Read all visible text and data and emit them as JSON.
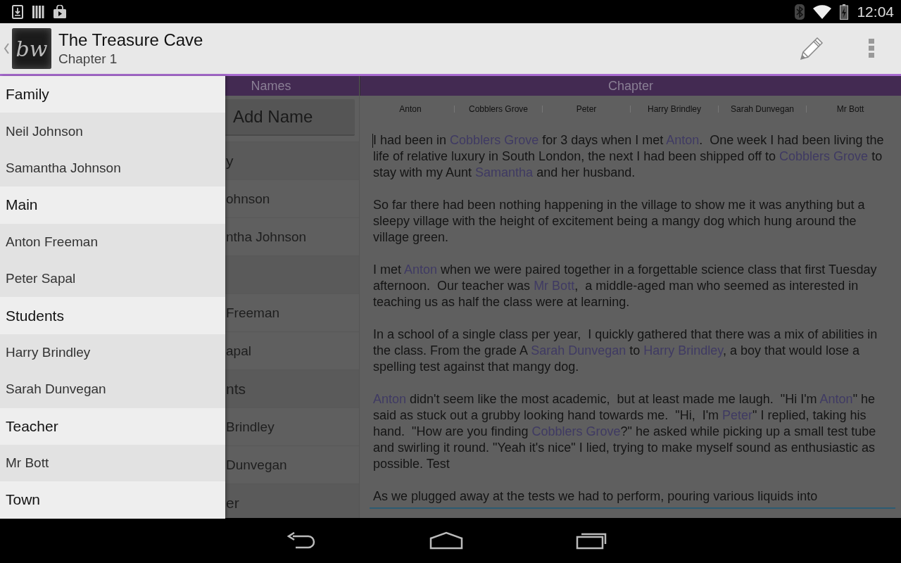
{
  "status_bar": {
    "time": "12:04"
  },
  "action_bar": {
    "logo_text": "bw",
    "title": "The Treasure Cave",
    "subtitle": "Chapter 1"
  },
  "drawer": {
    "items": [
      {
        "kind": "header",
        "label": "Family"
      },
      {
        "kind": "name",
        "label": "Neil Johnson"
      },
      {
        "kind": "name",
        "label": "Samantha Johnson"
      },
      {
        "kind": "header",
        "label": "Main"
      },
      {
        "kind": "name",
        "label": "Anton Freeman"
      },
      {
        "kind": "name",
        "label": "Peter Sapal"
      },
      {
        "kind": "header",
        "label": "Students"
      },
      {
        "kind": "name",
        "label": "Harry Brindley"
      },
      {
        "kind": "name",
        "label": "Sarah Dunvegan"
      },
      {
        "kind": "header",
        "label": "Teacher"
      },
      {
        "kind": "name",
        "label": "Mr Bott"
      },
      {
        "kind": "header",
        "label": "Town"
      }
    ]
  },
  "names_panel": {
    "heading": "Names",
    "add_button": "Add Name",
    "rows": [
      {
        "kind": "header",
        "label": "y"
      },
      {
        "kind": "name",
        "label": "ohnson"
      },
      {
        "kind": "name",
        "label": "ntha Johnson"
      },
      {
        "kind": "header"
      },
      {
        "kind": "name",
        "label": "Freeman"
      },
      {
        "kind": "name",
        "label": "apal"
      },
      {
        "kind": "header",
        "label": "nts"
      },
      {
        "kind": "name",
        "label": "Brindley"
      },
      {
        "kind": "name",
        "label": "Dunvegan"
      },
      {
        "kind": "header",
        "label": "er"
      }
    ]
  },
  "chapter_panel": {
    "heading": "Chapter",
    "tags": [
      "Anton",
      "Cobblers Grove",
      "Peter",
      "Harry Brindley",
      "Sarah Dunvegan",
      "Mr Bott"
    ],
    "paragraphs": [
      [
        {
          "kind": "plain",
          "text": "I had been in "
        },
        {
          "kind": "name",
          "text": "Cobblers Grove"
        },
        {
          "kind": "plain",
          "text": " for 3 days when I met "
        },
        {
          "kind": "name",
          "text": "Anton"
        },
        {
          "kind": "plain",
          "text": ".  One week I had been living the life of relative luxury in South London, the next I had been shipped off to "
        },
        {
          "kind": "name",
          "text": "Cobblers Grove"
        },
        {
          "kind": "plain",
          "text": " to stay with my Aunt "
        },
        {
          "kind": "name",
          "text": "Samantha"
        },
        {
          "kind": "plain",
          "text": " and her husband."
        }
      ],
      [
        {
          "kind": "plain",
          "text": "So far there had been nothing happening in the village to show me it was anything but a sleepy village with the height of excitement being a mangy dog which hung around the village green."
        }
      ],
      [
        {
          "kind": "plain",
          "text": "I met "
        },
        {
          "kind": "name",
          "text": "Anton"
        },
        {
          "kind": "plain",
          "text": " when we were paired together in a forgettable science class that first Tuesday afternoon.  Our teacher was "
        },
        {
          "kind": "name",
          "text": "Mr Bott"
        },
        {
          "kind": "plain",
          "text": ",  a middle-aged man who seemed as interested in teaching us as half the class were at learning."
        }
      ],
      [
        {
          "kind": "plain",
          "text": "In a school of a single class per year,  I quickly gathered that there was a mix of abilities in the class. From the grade A "
        },
        {
          "kind": "name",
          "text": "Sarah Dunvegan"
        },
        {
          "kind": "plain",
          "text": " to "
        },
        {
          "kind": "name",
          "text": "Harry Brindley"
        },
        {
          "kind": "plain",
          "text": ", a boy that would lose a spelling test against that mangy dog."
        }
      ],
      [
        {
          "kind": "name",
          "text": "Anton"
        },
        {
          "kind": "plain",
          "text": " didn't seem like the most academic,  but at least made me laugh.  \"Hi I'm "
        },
        {
          "kind": "name",
          "text": "Anton"
        },
        {
          "kind": "plain",
          "text": "\" he said as stuck out a grubby looking hand towards me.  \"Hi,  I'm "
        },
        {
          "kind": "name",
          "text": "Peter"
        },
        {
          "kind": "plain",
          "text": "\" I replied, taking his hand.  \"How are you finding "
        },
        {
          "kind": "name",
          "text": "Cobblers Grove"
        },
        {
          "kind": "plain",
          "text": "?\" he asked while picking up a small test tube and swirling it round. \"Yeah it's nice\" I lied, trying to make myself sound as enthusiastic as possible. Test"
        }
      ],
      [
        {
          "kind": "plain",
          "text": "As we plugged away at the tests we had to perform, pouring various liquids into"
        }
      ]
    ]
  }
}
